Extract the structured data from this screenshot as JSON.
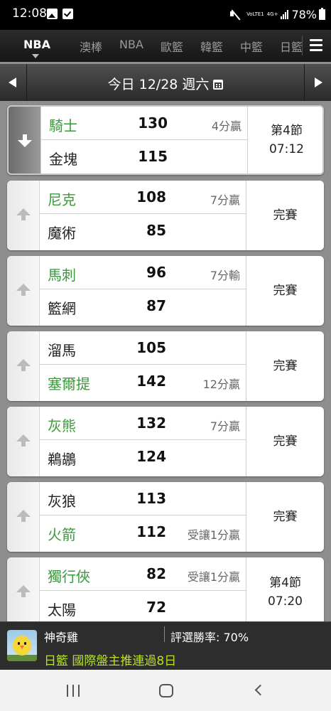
{
  "status_bar": {
    "time": "12:08",
    "volte": "VoLTE1",
    "network": "4G+",
    "battery": "78%"
  },
  "tabs": [
    {
      "label": "NBA",
      "active": true
    },
    {
      "label": "澳棒",
      "active": false
    },
    {
      "label": "NBA",
      "active": false
    },
    {
      "label": "歐籃",
      "active": false
    },
    {
      "label": "韓籃",
      "active": false
    },
    {
      "label": "中籃",
      "active": false
    },
    {
      "label": "日籃",
      "active": false
    }
  ],
  "date_bar": {
    "label": "今日 12/28 週六"
  },
  "games": [
    {
      "home": {
        "name": "騎士",
        "score": "130",
        "note": "4分贏",
        "winner": true
      },
      "away": {
        "name": "金塊",
        "score": "115",
        "note": "",
        "winner": false
      },
      "status": [
        "第4節",
        "07:12"
      ],
      "live": true
    },
    {
      "home": {
        "name": "尼克",
        "score": "108",
        "note": "7分贏",
        "winner": true
      },
      "away": {
        "name": "魔術",
        "score": "85",
        "note": "",
        "winner": false
      },
      "status": [
        "完賽"
      ],
      "live": false
    },
    {
      "home": {
        "name": "馬刺",
        "score": "96",
        "note": "7分輸",
        "winner": true
      },
      "away": {
        "name": "籃網",
        "score": "87",
        "note": "",
        "winner": false
      },
      "status": [
        "完賽"
      ],
      "live": false
    },
    {
      "home": {
        "name": "溜馬",
        "score": "105",
        "note": "",
        "winner": false
      },
      "away": {
        "name": "塞爾提",
        "score": "142",
        "note": "12分贏",
        "winner": true
      },
      "status": [
        "完賽"
      ],
      "live": false
    },
    {
      "home": {
        "name": "灰熊",
        "score": "132",
        "note": "7分贏",
        "winner": true
      },
      "away": {
        "name": "鵜鶘",
        "score": "124",
        "note": "",
        "winner": false
      },
      "status": [
        "完賽"
      ],
      "live": false
    },
    {
      "home": {
        "name": "灰狼",
        "score": "113",
        "note": "",
        "winner": false
      },
      "away": {
        "name": "火箭",
        "score": "112",
        "note": "受讓1分贏",
        "winner": true
      },
      "status": [
        "完賽"
      ],
      "live": false
    },
    {
      "home": {
        "name": "獨行俠",
        "score": "82",
        "note": "受讓1分贏",
        "winner": true
      },
      "away": {
        "name": "太陽",
        "score": "72",
        "note": "",
        "winner": false
      },
      "status": [
        "第4節",
        "07:20"
      ],
      "live": false
    }
  ],
  "banner": {
    "name": "神奇雞",
    "win_rate": "評選勝率: 70%",
    "promo": "日籃 國際盤主推連過8日"
  },
  "colors": {
    "winner_green": "#3a9a3a",
    "promo_lime": "#b8e02a",
    "header_dark": "#161616",
    "list_background": "#8e8e8e"
  }
}
